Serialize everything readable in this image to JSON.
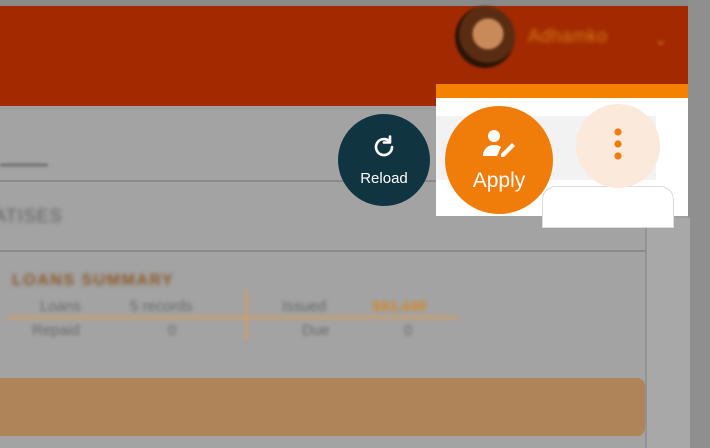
{
  "header": {
    "username": "Adhamko",
    "avatar": "user-avatar",
    "chevron": "⌄"
  },
  "tabs": {
    "section_label": "ATISES"
  },
  "loans_summary": {
    "title": "LOANS SUMMARY",
    "rows": [
      {
        "label": "Loans",
        "value": "5 records",
        "label2": "Issued",
        "value2": "$93,448"
      },
      {
        "label": "Repaid",
        "value": "0",
        "label2": "Due",
        "value2": "0"
      }
    ]
  },
  "actions": {
    "reload_label": "Reload",
    "reload_icon": "refresh-icon",
    "apply_label": "Apply",
    "apply_icon": "user-edit-icon",
    "more_icon": "kebab-menu-icon"
  },
  "colors": {
    "header_bg": "#a32a00",
    "accent_orange": "#f07c0a",
    "reload_bg": "#103541",
    "more_bg": "#fbe9dc"
  }
}
